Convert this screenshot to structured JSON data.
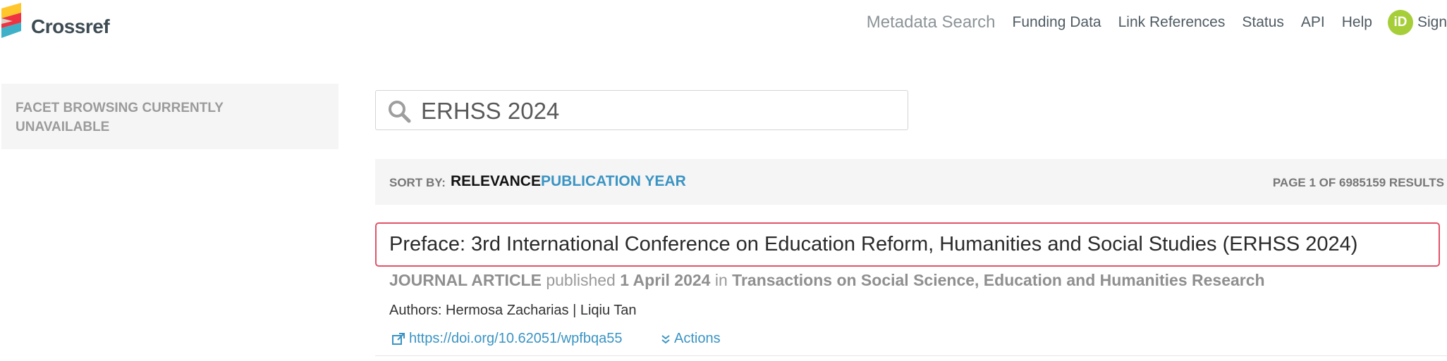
{
  "brand": {
    "name": "Crossref",
    "colors": [
      "#ffc72c",
      "#ef3340",
      "#3eb1c8",
      "#d8d2c4"
    ]
  },
  "nav": {
    "metadata_search": "Metadata Search",
    "funding_data": "Funding Data",
    "link_references": "Link References",
    "status": "Status",
    "api": "API",
    "help": "Help",
    "orcid_label": "iD",
    "sign": "Sign"
  },
  "sidebar": {
    "facet_message": "FACET BROWSING CURRENTLY UNAVAILABLE"
  },
  "search": {
    "value": "ERHSS 2024",
    "icon": "search-icon"
  },
  "sort": {
    "label": "SORT BY:",
    "relevance": "RELEVANCE",
    "publication_year": "PUBLICATION YEAR",
    "page_info": "PAGE 1 OF 6985159 RESULTS"
  },
  "result": {
    "title": "Preface: 3rd International Conference on Education Reform, Humanities and Social Studies (ERHSS 2024)",
    "type": "JOURNAL ARTICLE",
    "published_word": "published",
    "date": "1 April 2024",
    "in_word": "in",
    "journal": "Transactions on Social Science, Education and Humanities Research",
    "authors": "Authors: Hermosa Zacharias | Liqiu Tan",
    "doi": "https://doi.org/10.62051/wpfbqa55",
    "actions": "Actions"
  },
  "colors": {
    "accent_link": "#3a94c3",
    "highlight_border": "#e2536a",
    "orcid_green": "#a6ce39"
  }
}
